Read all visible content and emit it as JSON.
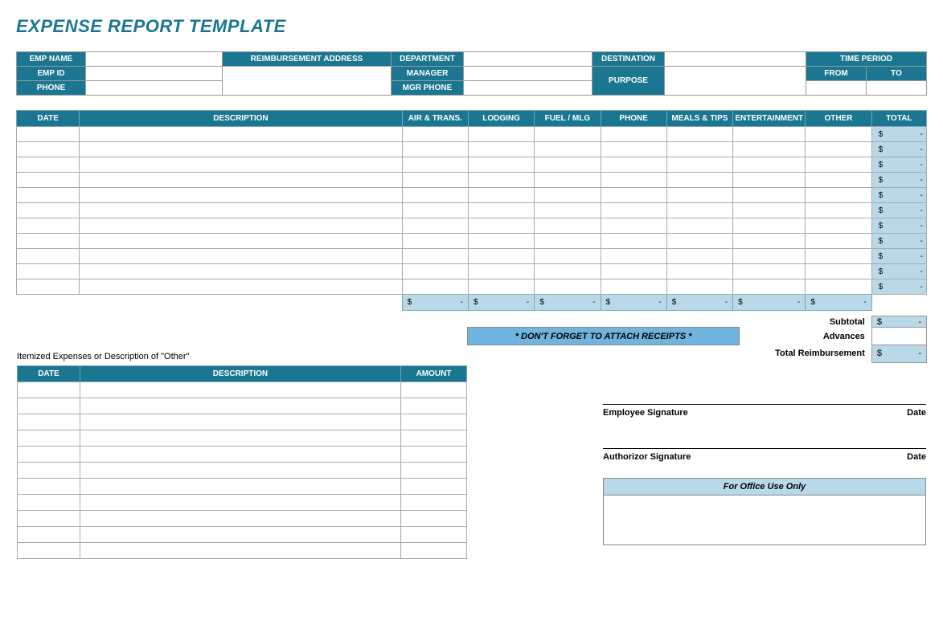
{
  "title": "EXPENSE REPORT TEMPLATE",
  "header": {
    "emp_name": "EMP NAME",
    "emp_id": "EMP ID",
    "phone": "PHONE",
    "reimb_addr": "REIMBURSEMENT ADDRESS",
    "department": "DEPARTMENT",
    "manager": "MANAGER",
    "mgr_phone": "MGR PHONE",
    "destination": "DESTINATION",
    "purpose": "PURPOSE",
    "time_period": "TIME PERIOD",
    "from": "FROM",
    "to": "TO"
  },
  "cols": {
    "date": "DATE",
    "desc": "DESCRIPTION",
    "air": "AIR & TRANS.",
    "lodging": "LODGING",
    "fuel": "FUEL / MLG",
    "phone": "PHONE",
    "meals": "MEALS & TIPS",
    "ent": "ENTERTAINMENT",
    "other": "OTHER",
    "total": "TOTAL",
    "amount": "AMOUNT"
  },
  "expense_rows": [
    {
      "total_d": "$",
      "total_v": "-"
    },
    {
      "total_d": "$",
      "total_v": "-"
    },
    {
      "total_d": "$",
      "total_v": "-"
    },
    {
      "total_d": "$",
      "total_v": "-"
    },
    {
      "total_d": "$",
      "total_v": "-"
    },
    {
      "total_d": "$",
      "total_v": "-"
    },
    {
      "total_d": "$",
      "total_v": "-"
    },
    {
      "total_d": "$",
      "total_v": "-"
    },
    {
      "total_d": "$",
      "total_v": "-"
    },
    {
      "total_d": "$",
      "total_v": "-"
    },
    {
      "total_d": "$",
      "total_v": "-"
    }
  ],
  "col_totals": [
    {
      "d": "$",
      "v": "-"
    },
    {
      "d": "$",
      "v": "-"
    },
    {
      "d": "$",
      "v": "-"
    },
    {
      "d": "$",
      "v": "-"
    },
    {
      "d": "$",
      "v": "-"
    },
    {
      "d": "$",
      "v": "-"
    },
    {
      "d": "$",
      "v": "-"
    }
  ],
  "summary": {
    "subtotal_lbl": "Subtotal",
    "subtotal_d": "$",
    "subtotal_v": "-",
    "advances_lbl": "Advances",
    "reimb_lbl": "Total Reimbursement",
    "reimb_d": "$",
    "reimb_v": "-"
  },
  "receipts_note": "* DON'T FORGET TO ATTACH RECEIPTS *",
  "itemized_caption": "Itemized Expenses or Description of \"Other\"",
  "item_rows": 11,
  "signatures": {
    "emp": "Employee Signature",
    "auth": "Authorizor Signature",
    "date": "Date"
  },
  "office_use": "For Office Use Only"
}
